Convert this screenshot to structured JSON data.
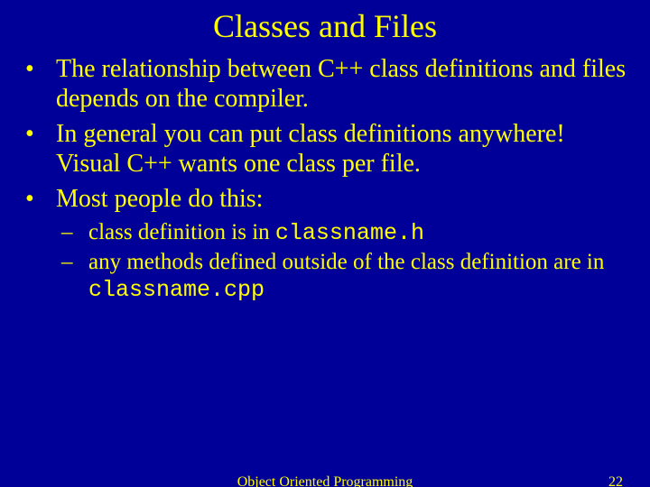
{
  "title": "Classes and Files",
  "bullets": [
    "The relationship between C++ class definitions and files depends on the compiler.",
    "In general you can put class definitions anywhere! Visual C++ wants one class per file.",
    "Most people do this:"
  ],
  "sub": {
    "a_pre": "class definition is in ",
    "a_code": "classname.h",
    "b_pre": "any methods defined outside of the class definition are in ",
    "b_code": "classname.cpp"
  },
  "footer": {
    "center": "Object Oriented Programming",
    "page": "22"
  }
}
